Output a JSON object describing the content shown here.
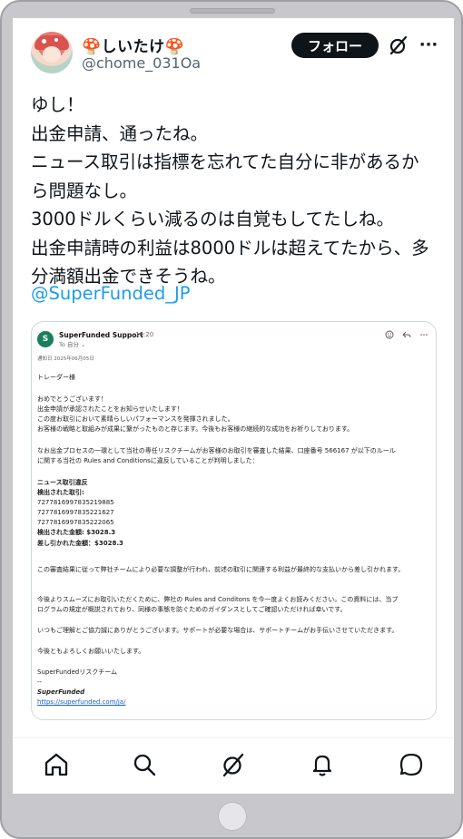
{
  "post": {
    "display_name": "🍄しいたけ🍄",
    "handle": "@chome_031Oa",
    "follow_label": "フォロー",
    "more_label": "···",
    "text_lines": [
      "ゆし！",
      "出金申請、通ったね。",
      "ニュース取引は指標を忘れてた自分に非があるか",
      "ら問題なし。",
      "3000ドルくらい減るのは自覚もしてたしね。",
      "出金申請時の利益は8000ドルは超えてたから、多",
      "分満額出金できそうね。"
    ],
    "mention": "@SuperFunded_JP"
  },
  "email": {
    "avatar_letter": "S",
    "sender": "SuperFunded Support",
    "time": "16:20",
    "to": "To 自分 ⌄",
    "date": "通知日 2025年06月05日",
    "greeting": "トレーダー様",
    "p1": [
      "おめでとうございます！",
      "出金申請が承認されたことをお知らせいたします！",
      "この度お取引において素晴らしいパフォーマンスを発揮されました。",
      "お客様の戦略と取組みが成果に繋がったものと存じます。今後もお客様の継続的な成功をお祈りしております。"
    ],
    "p2": [
      "なお出金プロセスの一環として当社の専任リスクチームがお客様のお取引を審査した結果、口座番号 566167 が以下のルール",
      "に関する当社の Rules and Conditionsに違反していることが判明しました："
    ],
    "violation_title": "ニュース取引違反",
    "detected_label": "検出された取引:",
    "trade_ids": [
      "7277816997835219885",
      "7277816997835221627",
      "7277816997835222065"
    ],
    "detected_amount": "検出された金額: $3028.3",
    "deducted_amount": "差し引かれた金額：$3028.3",
    "p3": "この審査結果に従って弊社チームにより必要な調整が行われ、前述の取引に関連する利益が最終的な支払いから差し引かれます。",
    "p4": [
      "今後よりスムーズにお取引いただくために、弊社の Rules and Conditons を今一度よくお読みください。この資料には、当プ",
      "ログラムの規定が概説されており、同様の事態を防ぐためのガイダンスとしてご確認いただければ幸いです。"
    ],
    "p5": "いつもご理解とご協力誠にありがとうございます。サポートが必要な場合は、サポートチームがお手伝いさせていただきます。",
    "p6": "今後ともよろしくお願いいたします。",
    "team": "SuperFundedリスクチーム",
    "sep": "--",
    "brand": "SuperFunded",
    "url": "https://superfunded.com/ja/"
  },
  "nav": {
    "items": [
      "home-icon",
      "search-icon",
      "grok-icon",
      "notifications-icon",
      "messages-icon"
    ]
  },
  "colors": {
    "accent": "#1d9bf0",
    "text": "#0f1419",
    "muted": "#536471",
    "frame": "#c8c8cc"
  }
}
